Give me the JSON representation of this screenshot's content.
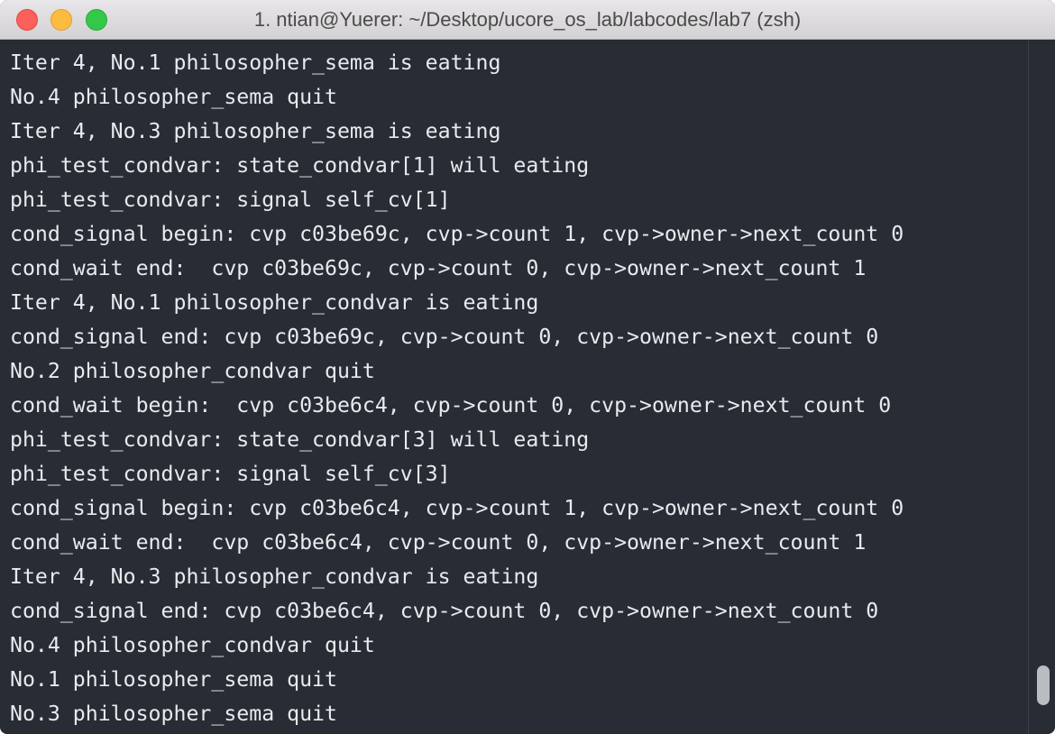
{
  "window": {
    "title": "1. ntian@Yuerer: ~/Desktop/ucore_os_lab/labcodes/lab7 (zsh)",
    "background_color": "#282c34",
    "text_color": "#e8eaee"
  },
  "terminal": {
    "lines": [
      "Iter 4, No.1 philosopher_sema is eating",
      "No.4 philosopher_sema quit",
      "Iter 4, No.3 philosopher_sema is eating",
      "phi_test_condvar: state_condvar[1] will eating",
      "phi_test_condvar: signal self_cv[1]",
      "cond_signal begin: cvp c03be69c, cvp->count 1, cvp->owner->next_count 0",
      "cond_wait end:  cvp c03be69c, cvp->count 0, cvp->owner->next_count 1",
      "Iter 4, No.1 philosopher_condvar is eating",
      "cond_signal end: cvp c03be69c, cvp->count 0, cvp->owner->next_count 0",
      "No.2 philosopher_condvar quit",
      "cond_wait begin:  cvp c03be6c4, cvp->count 0, cvp->owner->next_count 0",
      "phi_test_condvar: state_condvar[3] will eating",
      "phi_test_condvar: signal self_cv[3]",
      "cond_signal begin: cvp c03be6c4, cvp->count 1, cvp->owner->next_count 0",
      "cond_wait end:  cvp c03be6c4, cvp->count 0, cvp->owner->next_count 1",
      "Iter 4, No.3 philosopher_condvar is eating",
      "cond_signal end: cvp c03be6c4, cvp->count 0, cvp->owner->next_count 0",
      "No.4 philosopher_condvar quit",
      "No.1 philosopher_sema quit",
      "No.3 philosopher_sema quit"
    ]
  },
  "scrollbar": {
    "position_fraction": 1.0
  }
}
